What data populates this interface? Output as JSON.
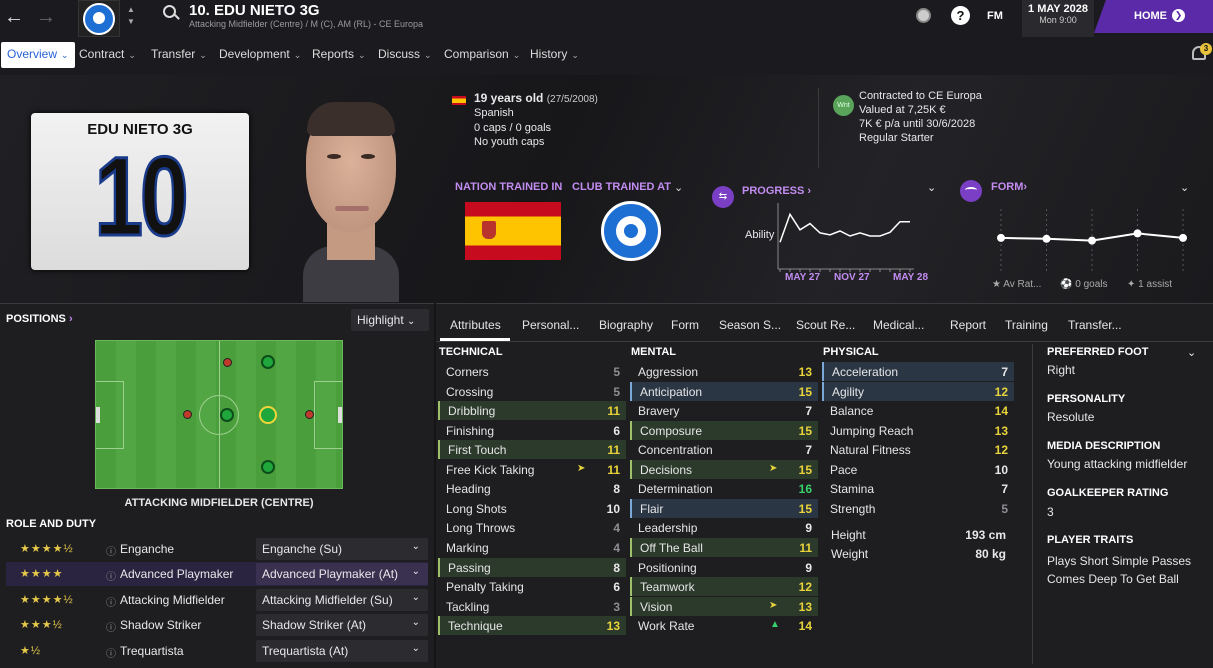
{
  "header": {
    "player_title": "10. EDU NIETO 3G",
    "subtitle": "Attacking Midfielder (Centre) / M (C), AM (RL) - CE Europa",
    "fm_label": "FM",
    "date": "1 MAY 2028",
    "time": "Mon 9:00",
    "home_label": "HOME",
    "notification_count": "3"
  },
  "nav": {
    "items": [
      "Overview",
      "Contract",
      "Transfer",
      "Development",
      "Reports",
      "Discuss",
      "Comparison",
      "History"
    ]
  },
  "hero": {
    "card_name": "EDU NIETO 3G",
    "shirt_number": "10",
    "age": "19 years old",
    "dob": "(27/5/2008)",
    "nationality": "Spanish",
    "caps": "0 caps / 0 goals",
    "youth_caps": "No youth caps",
    "club_badge": "Wnt",
    "contract": [
      "Contracted to CE Europa",
      "Valued at 7,25K €",
      "7K € p/a until 30/6/2028",
      "Regular Starter"
    ],
    "nation_trained": "NATION TRAINED IN",
    "club_trained": "CLUB TRAINED AT",
    "progress_label": "PROGRESS",
    "progress_axis": "Ability",
    "progress_ticks": [
      "MAY 27",
      "NOV 27",
      "MAY 28"
    ],
    "progress_values": [
      40,
      85,
      60,
      70,
      55,
      52,
      58,
      50,
      55,
      50,
      50,
      56,
      73,
      73
    ],
    "form_label": "FORM",
    "form_values": [
      6.9,
      6.8,
      6.6,
      7.4,
      6.9
    ],
    "form_stats": [
      "Av Rat...",
      "0 goals",
      "1 assist"
    ]
  },
  "positions": {
    "label": "POSITIONS",
    "highlight": "Highlight",
    "position_name": "ATTACKING MIDFIELDER (CENTRE)"
  },
  "roles": {
    "label": "ROLE AND DUTY",
    "items": [
      {
        "stars": "★★★★½",
        "name": "Enganche",
        "duty": "Enganche (Su)"
      },
      {
        "stars": "★★★★",
        "name": "Advanced Playmaker",
        "duty": "Advanced Playmaker (At)"
      },
      {
        "stars": "★★★★½",
        "name": "Attacking Midfielder",
        "duty": "Attacking Midfielder (Su)"
      },
      {
        "stars": "★★★½",
        "name": "Shadow Striker",
        "duty": "Shadow Striker (At)"
      },
      {
        "stars": "★½",
        "name": "Trequartista",
        "duty": "Trequartista (At)"
      }
    ]
  },
  "tabs": [
    "Attributes",
    "Personal...",
    "Biography",
    "Form",
    "Season S...",
    "Scout Re...",
    "Medical...",
    "Report",
    "Training",
    "Transfer..."
  ],
  "technical": {
    "label": "TECHNICAL",
    "rows": [
      {
        "n": "Corners",
        "v": "5"
      },
      {
        "n": "Crossing",
        "v": "5"
      },
      {
        "n": "Dribbling",
        "v": "11"
      },
      {
        "n": "Finishing",
        "v": "6"
      },
      {
        "n": "First Touch",
        "v": "11"
      },
      {
        "n": "Free Kick Taking",
        "v": "11"
      },
      {
        "n": "Heading",
        "v": "8"
      },
      {
        "n": "Long Shots",
        "v": "10"
      },
      {
        "n": "Long Throws",
        "v": "4"
      },
      {
        "n": "Marking",
        "v": "4"
      },
      {
        "n": "Passing",
        "v": "8"
      },
      {
        "n": "Penalty Taking",
        "v": "6"
      },
      {
        "n": "Tackling",
        "v": "3"
      },
      {
        "n": "Technique",
        "v": "13"
      }
    ]
  },
  "mental": {
    "label": "MENTAL",
    "rows": [
      {
        "n": "Aggression",
        "v": "13"
      },
      {
        "n": "Anticipation",
        "v": "15"
      },
      {
        "n": "Bravery",
        "v": "7"
      },
      {
        "n": "Composure",
        "v": "15"
      },
      {
        "n": "Concentration",
        "v": "7"
      },
      {
        "n": "Decisions",
        "v": "15"
      },
      {
        "n": "Determination",
        "v": "16"
      },
      {
        "n": "Flair",
        "v": "15"
      },
      {
        "n": "Leadership",
        "v": "9"
      },
      {
        "n": "Off The Ball",
        "v": "11"
      },
      {
        "n": "Positioning",
        "v": "9"
      },
      {
        "n": "Teamwork",
        "v": "12"
      },
      {
        "n": "Vision",
        "v": "13"
      },
      {
        "n": "Work Rate",
        "v": "14"
      }
    ]
  },
  "physical": {
    "label": "PHYSICAL",
    "rows": [
      {
        "n": "Acceleration",
        "v": "7"
      },
      {
        "n": "Agility",
        "v": "12"
      },
      {
        "n": "Balance",
        "v": "14"
      },
      {
        "n": "Jumping Reach",
        "v": "13"
      },
      {
        "n": "Natural Fitness",
        "v": "12"
      },
      {
        "n": "Pace",
        "v": "10"
      },
      {
        "n": "Stamina",
        "v": "7"
      },
      {
        "n": "Strength",
        "v": "5"
      }
    ],
    "height_label": "Height",
    "height": "193 cm",
    "weight_label": "Weight",
    "weight": "80 kg"
  },
  "info": {
    "foot_label": "PREFERRED FOOT",
    "foot": "Right",
    "personality_label": "PERSONALITY",
    "personality": "Resolute",
    "media_label": "MEDIA DESCRIPTION",
    "media": "Young attacking midfielder",
    "gk_label": "GOALKEEPER RATING",
    "gk": "3",
    "traits_label": "PLAYER TRAITS",
    "traits": [
      "Plays Short Simple Passes",
      "Comes Deep To Get Ball"
    ]
  },
  "colors": {
    "accent_purple": "#5b2aa8",
    "pitch_green": "#4a9e3c",
    "high": "#e8d33a",
    "top": "#37d26a"
  }
}
